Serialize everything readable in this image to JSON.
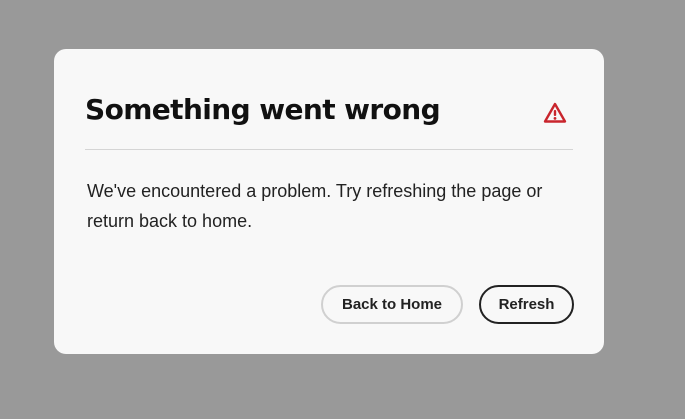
{
  "dialog": {
    "title": "Something went wrong",
    "icon": "alert-triangle-icon",
    "message": "We've encountered a problem. Try refreshing the page or return back to home.",
    "buttons": {
      "back_home_label": "Back to Home",
      "refresh_label": "Refresh"
    }
  },
  "colors": {
    "backdrop": "#999999",
    "dialog_background": "#f8f8f8",
    "alert_icon": "#c9252d",
    "text": "#222222"
  }
}
